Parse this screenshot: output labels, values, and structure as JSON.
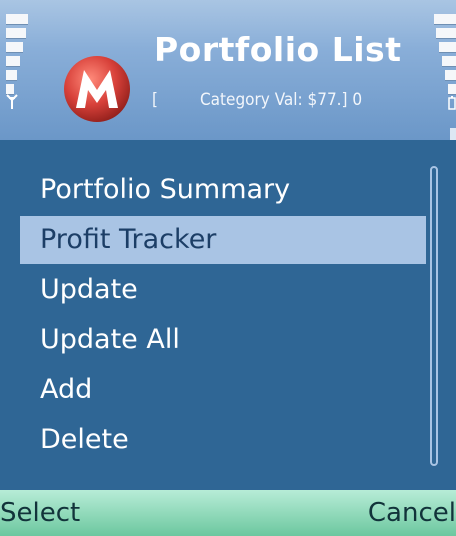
{
  "header": {
    "title": "Portfolio List",
    "subtitle_bracket_open": "[",
    "subtitle_text": "Category Val: $77.] 0",
    "logo_letter": "M"
  },
  "menu": {
    "items": [
      {
        "label": "Portfolio Summary",
        "selected": false
      },
      {
        "label": "Profit Tracker",
        "selected": true
      },
      {
        "label": "Update",
        "selected": false
      },
      {
        "label": "Update All",
        "selected": false
      },
      {
        "label": "Add",
        "selected": false
      },
      {
        "label": "Delete",
        "selected": false
      }
    ]
  },
  "softkeys": {
    "left": "Select",
    "right": "Cancel"
  },
  "colors": {
    "list_background": "#2f6695",
    "selection_highlight": "#a9c4e4",
    "softkey_bar": "#8ed8b8",
    "logo_red": "#d8413a"
  },
  "icons": {
    "signal": "signal-strength-icon",
    "battery": "battery-level-icon",
    "antenna": "antenna-icon",
    "logo": "app-logo-icon"
  }
}
